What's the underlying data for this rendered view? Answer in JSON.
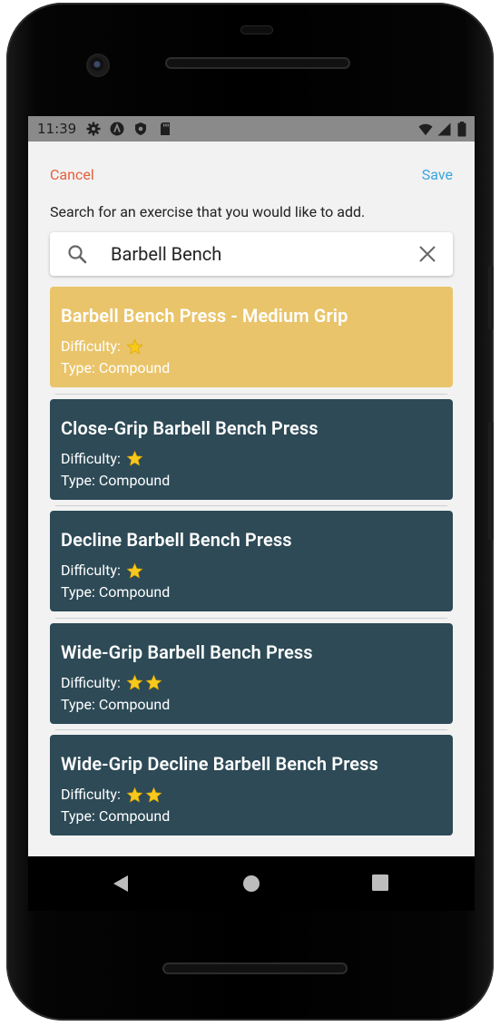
{
  "status": {
    "time": "11:39"
  },
  "header": {
    "cancel_label": "Cancel",
    "save_label": "Save"
  },
  "instructions": "Search for an exercise that you would like to add.",
  "search": {
    "value": "Barbell Bench",
    "icon": "search-icon",
    "clear_icon": "close-icon"
  },
  "labels": {
    "difficulty": "Difficulty:",
    "type_prefix": "Type:"
  },
  "colors": {
    "selected_card": "#E9C46A",
    "card": "#2D4A56",
    "cancel": "#E2603B",
    "save": "#3AA5DF",
    "star": "#F7C91D"
  },
  "results": [
    {
      "title": "Barbell Bench Press - Medium Grip",
      "difficulty_stars": 1,
      "type": "Type: Compound",
      "selected": true
    },
    {
      "title": "Close-Grip Barbell Bench Press",
      "difficulty_stars": 1,
      "type": "Type: Compound",
      "selected": false
    },
    {
      "title": "Decline Barbell Bench Press",
      "difficulty_stars": 1,
      "type": "Type: Compound",
      "selected": false
    },
    {
      "title": "Wide-Grip Barbell Bench Press",
      "difficulty_stars": 2,
      "type": "Type: Compound",
      "selected": false
    },
    {
      "title": "Wide-Grip Decline Barbell Bench Press",
      "difficulty_stars": 2,
      "type": "Type: Compound",
      "selected": false
    }
  ],
  "navigation": {
    "back_icon": "back-icon",
    "home_icon": "home-icon",
    "recents_icon": "recents-icon"
  }
}
